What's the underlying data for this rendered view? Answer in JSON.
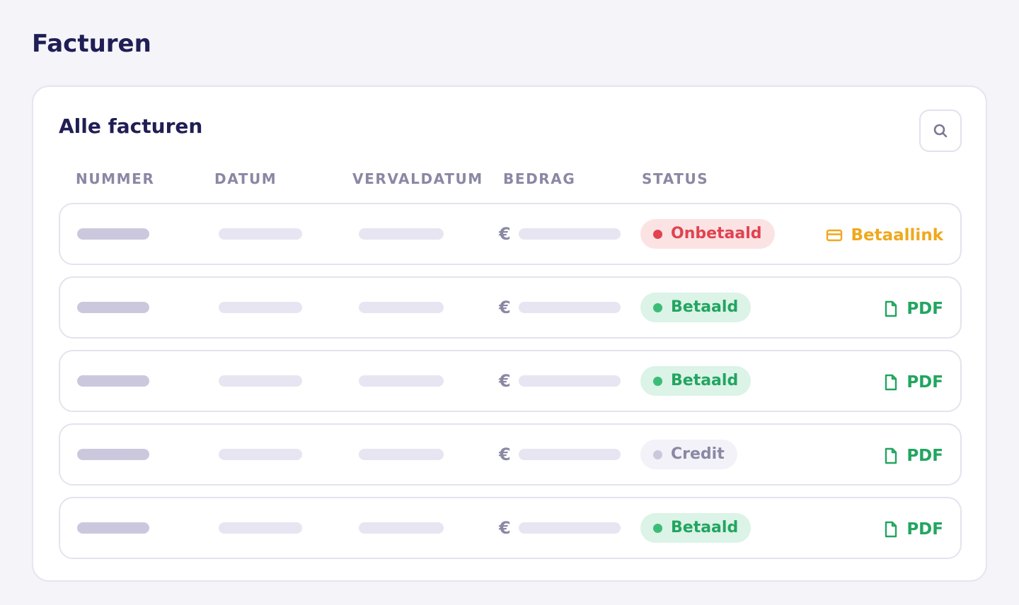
{
  "page": {
    "title": "Facturen"
  },
  "card": {
    "title": "Alle facturen",
    "search_icon": "search-icon"
  },
  "table": {
    "columns": [
      "NUMMER",
      "DATUM",
      "VERVALDATUM",
      "BEDRAG",
      "STATUS"
    ],
    "currency_symbol": "€",
    "rows": [
      {
        "status": "Onbetaald",
        "status_type": "unpaid",
        "action": "Betaallink",
        "action_icon": "credit-card-icon"
      },
      {
        "status": "Betaald",
        "status_type": "paid",
        "action": "PDF",
        "action_icon": "file-icon"
      },
      {
        "status": "Betaald",
        "status_type": "paid",
        "action": "PDF",
        "action_icon": "file-icon"
      },
      {
        "status": "Credit",
        "status_type": "credit",
        "action": "PDF",
        "action_icon": "file-icon"
      },
      {
        "status": "Betaald",
        "status_type": "paid",
        "action": "PDF",
        "action_icon": "file-icon"
      }
    ]
  },
  "colors": {
    "background": "#f4f4f9",
    "title": "#201e55",
    "unpaid": "#e0434f",
    "paid": "#22a560",
    "pay_link": "#f0a81c",
    "muted": "#8a88a4"
  }
}
